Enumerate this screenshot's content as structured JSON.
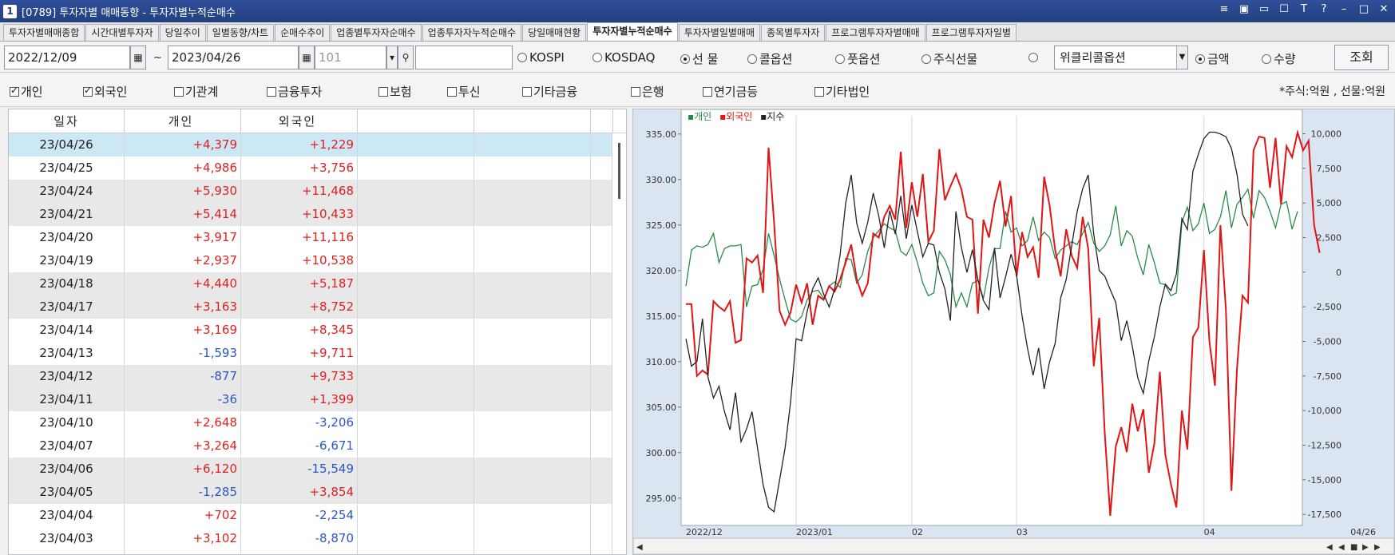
{
  "window": {
    "number": "1",
    "title": "[0789] 투자자별 매매동향 - 투자자별누적순매수",
    "controls": [
      "≡",
      "▣",
      "▭",
      "☐",
      "T",
      "?",
      "–",
      "□",
      "✕"
    ]
  },
  "tabs": [
    "투자자별매매종합",
    "시간대별투자자",
    "당일추이",
    "일별동향/차트",
    "순매수추이",
    "업종별투자자순매수",
    "업종투자자누적순매수",
    "당일매매현황",
    "투자자별누적순매수",
    "투자자별일별매매",
    "종목별투자자",
    "프로그램투자자별매매",
    "프로그램투자자일별"
  ],
  "active_tab": 8,
  "toolbar": {
    "start_date": "2022/12/09",
    "tilde": "~",
    "end_date": "2023/04/26",
    "code": "101",
    "code_extra": "",
    "markets": [
      {
        "label": "KOSPI",
        "selected": false
      },
      {
        "label": "KOSDAQ",
        "selected": false
      },
      {
        "label": "선 물",
        "selected": true
      },
      {
        "label": "콜옵션",
        "selected": false
      },
      {
        "label": "풋옵션",
        "selected": false
      },
      {
        "label": "주식선물",
        "selected": false
      },
      {
        "label": "",
        "selected": false
      }
    ],
    "weekly_select": "위클리콜옵션",
    "units": [
      {
        "label": "금액",
        "selected": true
      },
      {
        "label": "수량",
        "selected": false
      }
    ],
    "query_label": "조회"
  },
  "filters": {
    "investors": [
      {
        "label": "개인",
        "checked": true
      },
      {
        "label": "외국인",
        "checked": true
      },
      {
        "label": "기관계",
        "checked": false
      },
      {
        "label": "금융투자",
        "checked": false
      },
      {
        "label": "보험",
        "checked": false
      },
      {
        "label": "투신",
        "checked": false
      },
      {
        "label": "기타금융",
        "checked": false
      },
      {
        "label": "은행",
        "checked": false
      },
      {
        "label": "연기금등",
        "checked": false
      },
      {
        "label": "기타법인",
        "checked": false
      }
    ],
    "unit_note": "*주식:억원 , 선물:억원"
  },
  "table": {
    "headers": [
      "일자",
      "개인",
      "외국인",
      "",
      ""
    ],
    "rows": [
      {
        "date": "23/04/26",
        "individual": "+4,379",
        "foreign": "+1,229"
      },
      {
        "date": "23/04/25",
        "individual": "+4,986",
        "foreign": "+3,756"
      },
      {
        "date": "23/04/24",
        "individual": "+5,930",
        "foreign": "+11,468"
      },
      {
        "date": "23/04/21",
        "individual": "+5,414",
        "foreign": "+10,433"
      },
      {
        "date": "23/04/20",
        "individual": "+3,917",
        "foreign": "+11,116"
      },
      {
        "date": "23/04/19",
        "individual": "+2,937",
        "foreign": "+10,538"
      },
      {
        "date": "23/04/18",
        "individual": "+4,440",
        "foreign": "+5,187"
      },
      {
        "date": "23/04/17",
        "individual": "+3,163",
        "foreign": "+8,752"
      },
      {
        "date": "23/04/14",
        "individual": "+3,169",
        "foreign": "+8,345"
      },
      {
        "date": "23/04/13",
        "individual": "-1,593",
        "foreign": "+9,711"
      },
      {
        "date": "23/04/12",
        "individual": "-877",
        "foreign": "+9,733"
      },
      {
        "date": "23/04/11",
        "individual": "-36",
        "foreign": "+1,399"
      },
      {
        "date": "23/04/10",
        "individual": "+2,648",
        "foreign": "-3,206"
      },
      {
        "date": "23/04/07",
        "individual": "+3,264",
        "foreign": "-6,671"
      },
      {
        "date": "23/04/06",
        "individual": "+6,120",
        "foreign": "-15,549"
      },
      {
        "date": "23/04/05",
        "individual": "-1,285",
        "foreign": "+3,854"
      },
      {
        "date": "23/04/04",
        "individual": "+702",
        "foreign": "-2,254"
      },
      {
        "date": "23/04/03",
        "individual": "+3,102",
        "foreign": "-8,870"
      },
      {
        "date": "",
        "individual": "",
        "foreign": ""
      }
    ]
  },
  "colors": {
    "individual": "#2a8a4a",
    "foreign": "#e01515",
    "index": "#222222",
    "axis_bg": "#dbe5f1"
  },
  "chart_data": {
    "type": "line",
    "legend": [
      "개인",
      "외국인",
      "지수"
    ],
    "x_ticks": [
      "2022/12",
      "2023/01",
      "02",
      "03",
      "04",
      "04/26"
    ],
    "left_axis": {
      "ticks": [
        "335.00",
        "330.00",
        "325.00",
        "320.00",
        "315.00",
        "310.00",
        "305.00",
        "300.00",
        "295.00"
      ],
      "range": [
        292,
        337
      ]
    },
    "right_axis": {
      "ticks": [
        "10,000",
        "7,500",
        "5,000",
        "2,500",
        "0",
        "-2,500",
        "-5,000",
        "-7,500",
        "-10,000",
        "-12,500",
        "-15,000",
        "-17,500"
      ],
      "range": [
        -18300,
        11300
      ]
    },
    "series": [
      {
        "name": "개인",
        "axis": "right",
        "values": [
          -1000,
          1600,
          1900,
          1800,
          2000,
          2800,
          700,
          1700,
          1900,
          1900,
          2000,
          -2500,
          -1000,
          -900,
          200,
          2800,
          1200,
          -500,
          -2000,
          -3400,
          -3600,
          -3200,
          -2000,
          -1400,
          -1300,
          -1900,
          -1000,
          -700,
          -1100,
          1000,
          900,
          -800,
          -200,
          1500,
          2500,
          3000,
          3500,
          3200,
          3000,
          1500,
          1200,
          2000,
          700,
          -800,
          -1700,
          -1500,
          1500,
          900,
          -200,
          -2500,
          -1500,
          -2500,
          -800,
          -600,
          -1900,
          300,
          1700,
          1700,
          4400,
          2900,
          3200,
          1900,
          2300,
          4000,
          2300,
          2900,
          2500,
          1000,
          1600,
          1900,
          2200,
          2000,
          2800,
          3600,
          2100,
          1500,
          1900,
          2700,
          4800,
          1900,
          3000,
          2600,
          1000,
          -200,
          2000,
          700,
          -800,
          -900,
          -1700,
          -1500,
          3600,
          4700,
          3000,
          3500,
          5000,
          2800,
          3100,
          4000,
          5900,
          3200,
          4900,
          5400,
          6000,
          3900,
          5900,
          5400,
          4400,
          3200,
          4900,
          5100,
          3100,
          4400
        ]
      },
      {
        "name": "외국인",
        "axis": "right",
        "values": [
          -2300,
          -2300,
          -7500,
          -7100,
          -7400,
          -2100,
          -2500,
          -2800,
          -2100,
          -5100,
          -4900,
          1000,
          700,
          1200,
          -1500,
          9000,
          3600,
          -2800,
          -3800,
          -2900,
          -900,
          -2200,
          -800,
          -3800,
          -1700,
          -2000,
          -1000,
          -1400,
          -500,
          700,
          2000,
          -500,
          -1700,
          -800,
          2800,
          2500,
          4000,
          4800,
          3800,
          8700,
          3200,
          6500,
          4000,
          7100,
          2200,
          3000,
          8900,
          5200,
          6200,
          7100,
          6000,
          4000,
          3800,
          -3000,
          3800,
          2500,
          5000,
          6600,
          3300,
          5500,
          -300,
          2900,
          1100,
          1800,
          -400,
          6900,
          4800,
          1600,
          -300,
          3100,
          1200,
          300,
          4000,
          1700,
          -6800,
          -3300,
          -11600,
          -17600,
          -12600,
          -11200,
          -13000,
          -9500,
          -11500,
          -9900,
          -14500,
          -12400,
          -7200,
          -13200,
          -15300,
          -17000,
          -10000,
          -12800,
          -4700,
          -4000,
          1600,
          -5000,
          -8200,
          3400,
          -2800,
          -15800,
          -7000,
          -1700,
          -2200,
          8800,
          9800,
          9700,
          6100,
          9700,
          4900,
          9100,
          8300,
          10100,
          8800,
          9500,
          3400,
          1400
        ]
      },
      {
        "name": "지수",
        "axis": "left",
        "values": [
          312.5,
          309.5,
          310,
          314.7,
          308.3,
          306,
          307.3,
          304.5,
          302.5,
          306.6,
          301.2,
          302.6,
          304.5,
          300.5,
          296.5,
          294,
          293.5,
          297,
          300.5,
          305.6,
          312.5,
          312.3,
          315.5,
          318,
          319.2,
          317.4,
          316,
          318,
          321.8,
          327.4,
          330.5,
          325.2,
          323,
          325.3,
          328.5,
          326,
          322.5,
          326.6,
          324,
          328.2,
          323.5,
          327.2,
          324.3,
          321.5,
          323,
          322.8,
          319.8,
          318,
          314.5,
          326.5,
          322.5,
          319.8,
          322.3,
          319,
          316.7,
          315.7,
          322.5,
          317,
          319.3,
          321.8,
          319.5,
          315,
          311.4,
          308.5,
          311.5,
          307,
          310,
          312,
          317,
          319,
          322.7,
          326.5,
          329,
          330.5,
          324,
          320,
          319.4,
          317.9,
          316.5,
          312.3,
          314.5,
          311.7,
          308.2,
          306.5,
          310.1,
          312.7,
          316,
          318.5,
          317.8,
          319.6,
          325.7,
          324.5,
          330.9,
          332.8,
          334.5,
          335.2,
          335.2,
          335.0,
          334.7,
          333.4,
          330.6,
          326.2,
          324.9
        ]
      }
    ]
  }
}
